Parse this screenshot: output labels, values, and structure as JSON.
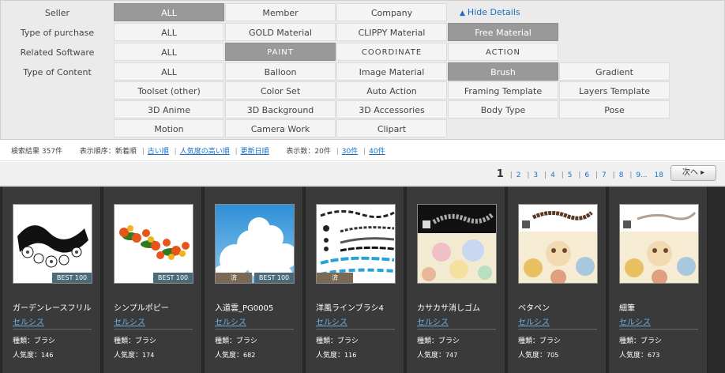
{
  "filters": {
    "hide_details": "Hide Details",
    "rows": [
      {
        "label": "Seller",
        "options": [
          {
            "text": "ALL",
            "selected": true
          },
          {
            "text": "Member",
            "selected": false
          },
          {
            "text": "Company",
            "selected": false
          }
        ]
      },
      {
        "label": "Type of purchase",
        "options": [
          {
            "text": "ALL",
            "selected": false
          },
          {
            "text": "GOLD Material",
            "selected": false
          },
          {
            "text": "CLIPPY Material",
            "selected": false
          },
          {
            "text": "Free Material",
            "selected": true
          }
        ]
      },
      {
        "label": "Related Software",
        "options": [
          {
            "text": "ALL",
            "selected": false
          },
          {
            "text": "PAINT",
            "selected": true
          },
          {
            "text": "COORDINATE",
            "selected": false
          },
          {
            "text": "ACTION",
            "selected": false
          }
        ]
      },
      {
        "label": "Type of Content",
        "options": [
          {
            "text": "ALL",
            "selected": false
          },
          {
            "text": "Balloon",
            "selected": false
          },
          {
            "text": "Image Material",
            "selected": false
          },
          {
            "text": "Brush",
            "selected": true
          },
          {
            "text": "Gradient",
            "selected": false
          },
          {
            "text": "Toolset (other)",
            "selected": false
          },
          {
            "text": "Color Set",
            "selected": false
          },
          {
            "text": "Auto Action",
            "selected": false
          },
          {
            "text": "Framing Template",
            "selected": false
          },
          {
            "text": "Layers Template",
            "selected": false
          },
          {
            "text": "3D Anime",
            "selected": false
          },
          {
            "text": "3D Background",
            "selected": false
          },
          {
            "text": "3D Accessories",
            "selected": false
          },
          {
            "text": "Body Type",
            "selected": false
          },
          {
            "text": "Pose",
            "selected": false
          },
          {
            "text": "Motion",
            "selected": false
          },
          {
            "text": "Camera Work",
            "selected": false
          },
          {
            "text": "Clipart",
            "selected": false
          }
        ]
      }
    ]
  },
  "results": {
    "count_text": "検索結果 357件",
    "sort_label": "表示順序：",
    "sort_current": "新着順",
    "sort_links": [
      "古い順",
      "人気度の高い順",
      "更新日順"
    ],
    "per_page_label": "表示数：",
    "per_page_current": "20件",
    "per_page_links": [
      "30件",
      "40件"
    ]
  },
  "pagination": {
    "current": "1",
    "pages": [
      "2",
      "3",
      "4",
      "5",
      "6",
      "7",
      "8",
      "9...",
      "18"
    ],
    "next_label": "次へ ▸"
  },
  "cards": [
    {
      "title": "ガーデンレースフリル",
      "author": "セルシス",
      "type_text": "種類：ブラシ",
      "pop_label": "人気度：",
      "pop_value": "146",
      "best": "BEST 100",
      "owned": ""
    },
    {
      "title": "シンプルポピー",
      "author": "セルシス",
      "type_text": "種類：ブラシ",
      "pop_label": "人気度：",
      "pop_value": "174",
      "best": "BEST 100",
      "owned": ""
    },
    {
      "title": "入道雲_PG0005",
      "author": "セルシス",
      "type_text": "種類：ブラシ",
      "pop_label": "人気度：",
      "pop_value": "682",
      "best": "BEST 100",
      "owned": "済"
    },
    {
      "title": "洋風ラインブラシ4",
      "author": "セルシス",
      "type_text": "種類：ブラシ",
      "pop_label": "人気度：",
      "pop_value": "116",
      "best": "",
      "owned": "済"
    },
    {
      "title": "カサカサ消しゴム",
      "author": "セルシス",
      "type_text": "種類：ブラシ",
      "pop_label": "人気度：",
      "pop_value": "747",
      "best": "",
      "owned": ""
    },
    {
      "title": "ベタペン",
      "author": "セルシス",
      "type_text": "種類：ブラシ",
      "pop_label": "人気度：",
      "pop_value": "705",
      "best": "",
      "owned": ""
    },
    {
      "title": "細筆",
      "author": "セルシス",
      "type_text": "種類：ブラシ",
      "pop_label": "人気度：",
      "pop_value": "673",
      "best": "",
      "owned": ""
    }
  ]
}
